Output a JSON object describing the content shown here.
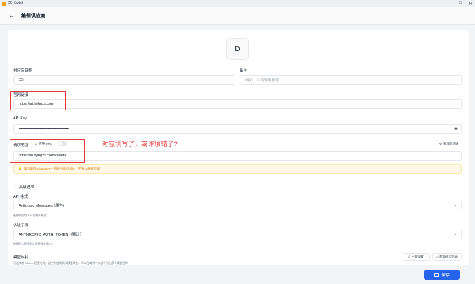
{
  "window": {
    "title": "CC Switch",
    "controls": [
      "—",
      "□",
      "✕"
    ]
  },
  "header": {
    "back_icon": "←",
    "title": "编辑供应商"
  },
  "avatar": {
    "letter": "D"
  },
  "fields": {
    "provider_name": {
      "label": "供应商名称",
      "value": "DS"
    },
    "notes": {
      "label": "备注",
      "placeholder": "例如：公司专用账号"
    },
    "website": {
      "label": "官网链接",
      "value": "https://ai.hybgzs.com"
    },
    "api_key": {
      "label": "API Key",
      "value": "••••••••••••••••••••••••••••••••••••••••••••••••••••••••••"
    },
    "request_url": {
      "label": "请求地址",
      "full_url_label": "完整 URL",
      "full_url_on": false,
      "value": "https://ai.hybgzs.com/claude"
    },
    "api_format": {
      "label": "API 格式",
      "value": "Anthropic Messages (原生)",
      "hint": "选择供应商 API 的输入格式"
    },
    "auth_field": {
      "label": "认证字段",
      "value": "ANTHROPIC_AUTH_TOKEN（默认）",
      "hint": "选择写入配置的认证环境变量名"
    },
    "model_mapping": {
      "label": "模型映射",
      "hint": "可选映射 Claude 模型名称，留空则使用默认模型映射，可以在每列中以逗号列出多个模型名称"
    }
  },
  "links": {
    "manage_test": "管理与测速"
  },
  "warning": {
    "text": "填写兼容 Claude API 的服务端点地址，不要以斜杠结尾"
  },
  "advanced": {
    "label": "高级选项",
    "chevron": "⌄"
  },
  "buttons": {
    "one_click_config": "一键设置",
    "fetch_models": "获取模型列表",
    "save": "保存"
  },
  "annotation": {
    "text": "对应填写了，或许填错了?"
  },
  "colors": {
    "accent": "#2563eb",
    "annotation_red": "#e5383b",
    "warning_text": "#d97706"
  }
}
